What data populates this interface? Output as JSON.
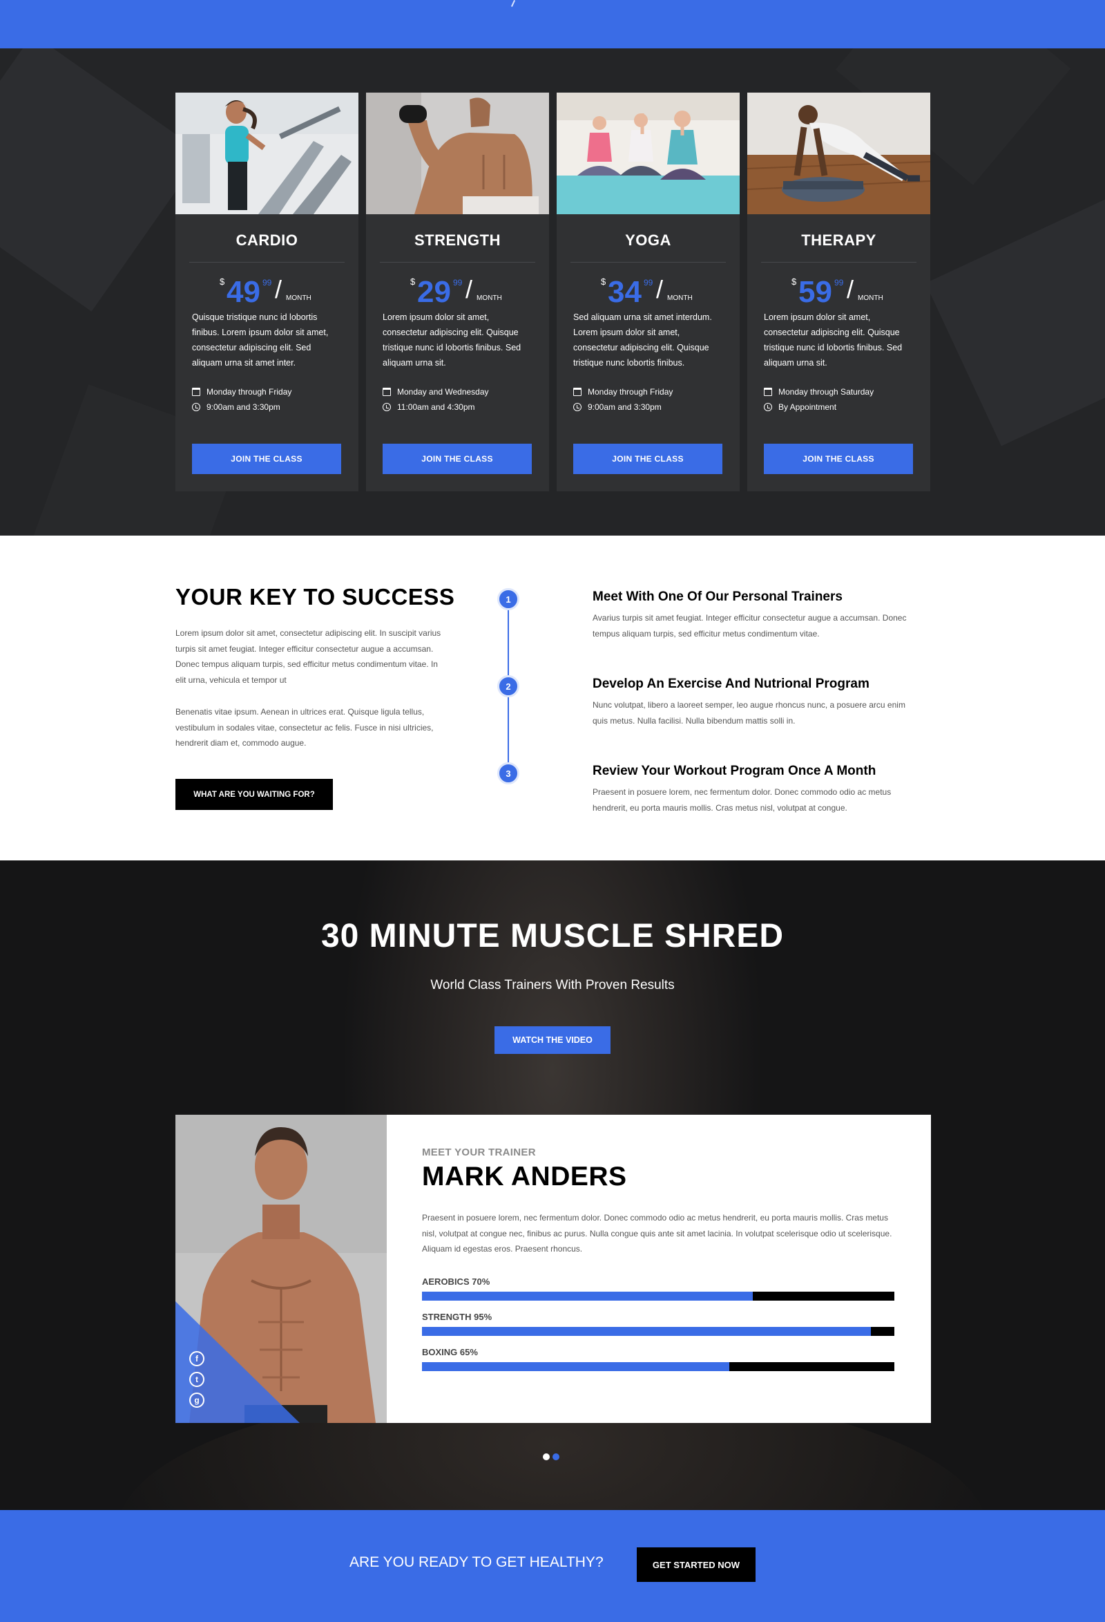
{
  "classes": [
    {
      "name": "CARDIO",
      "currency": "$",
      "amount": "49",
      "cents": "99",
      "period": "MONTH",
      "description": "Quisque tristique nunc id lobortis finibus. Lorem ipsum dolor sit amet, consectetur adipiscing elit. Sed aliquam urna sit amet inter.",
      "days": "Monday through Friday",
      "times": "9:00am and 3:30pm",
      "button": "JOIN THE CLASS"
    },
    {
      "name": "STRENGTH",
      "currency": "$",
      "amount": "29",
      "cents": "99",
      "period": "MONTH",
      "description": "Lorem ipsum dolor sit amet, consectetur adipiscing elit. Quisque tristique nunc id lobortis finibus. Sed aliquam urna sit.",
      "days": "Monday and Wednesday",
      "times": "11:00am and 4:30pm",
      "button": "JOIN THE CLASS"
    },
    {
      "name": "YOGA",
      "currency": "$",
      "amount": "34",
      "cents": "99",
      "period": "MONTH",
      "description": "Sed aliquam urna sit amet interdum. Lorem ipsum dolor sit amet, consectetur adipiscing elit. Quisque tristique nunc lobortis finibus.",
      "days": "Monday through Friday",
      "times": "9:00am and 3:30pm",
      "button": "JOIN THE CLASS"
    },
    {
      "name": "THERAPY",
      "currency": "$",
      "amount": "59",
      "cents": "99",
      "period": "MONTH",
      "description": "Lorem ipsum dolor sit amet, consectetur adipiscing elit. Quisque tristique nunc id lobortis finibus. Sed aliquam urna sit.",
      "days": "Monday through Saturday",
      "times": "By Appointment",
      "button": "JOIN THE CLASS"
    }
  ],
  "success": {
    "title": "YOUR KEY TO SUCCESS",
    "paragraph1": "Lorem ipsum dolor sit amet, consectetur adipiscing elit. In suscipit varius turpis sit amet feugiat. Integer efficitur consectetur augue a accumsan. Donec tempus aliquam turpis, sed efficitur metus condimentum vitae. In elit urna, vehicula et tempor ut",
    "paragraph2": "Benenatis vitae ipsum. Aenean in ultrices erat. Quisque ligula tellus, vestibulum in sodales vitae, consectetur ac felis. Fusce in nisi ultricies, hendrerit diam et, commodo augue.",
    "button": "WHAT ARE YOU WAITING FOR?",
    "steps": [
      {
        "number": "1",
        "title": "Meet With One Of Our Personal Trainers",
        "text": "Avarius turpis sit amet feugiat. Integer efficitur consectetur augue a accumsan. Donec tempus aliquam turpis, sed efficitur metus condimentum vitae."
      },
      {
        "number": "2",
        "title": "Develop An Exercise And Nutrional Program",
        "text": "Nunc volutpat, libero a laoreet semper, leo augue rhoncus nunc, a posuere arcu enim quis metus. Nulla facilisi. Nulla bibendum mattis solli in."
      },
      {
        "number": "3",
        "title": "Review Your Workout Program Once A Month",
        "text": "Praesent in posuere lorem, nec fermentum dolor. Donec commodo odio ac metus hendrerit, eu porta mauris mollis. Cras metus nisl, volutpat at congue."
      }
    ]
  },
  "shred": {
    "title": "30 MINUTE MUSCLE SHRED",
    "subtitle": "World Class Trainers With Proven Results",
    "button": "WATCH THE VIDEO"
  },
  "trainer": {
    "kicker": "MEET YOUR TRAINER",
    "name": "MARK ANDERS",
    "bio": "Praesent in posuere lorem, nec fermentum dolor. Donec commodo odio ac metus hendrerit, eu porta mauris mollis. Cras metus nisl, volutpat at congue nec, finibus ac purus. Nulla congue quis ante sit amet lacinia. In volutpat scelerisque odio ut scelerisque. Aliquam id egestas eros. Praesent rhoncus.",
    "skills": [
      {
        "label": "AEROBICS 70%",
        "percent": 70
      },
      {
        "label": "STRENGTH 95%",
        "percent": 95
      },
      {
        "label": "BOXING 65%",
        "percent": 65
      }
    ],
    "social": [
      {
        "icon": "facebook-icon",
        "glyph": "f"
      },
      {
        "icon": "twitter-icon",
        "glyph": "t"
      },
      {
        "icon": "google-plus-icon",
        "glyph": "g"
      }
    ]
  },
  "carousel": {
    "active_index": 0,
    "count": 2
  },
  "cta": {
    "text": "ARE YOU READY TO GET HEALTHY?",
    "button": "GET STARTED NOW"
  },
  "colors": {
    "accent": "#3a6ce6",
    "dark": "#242527",
    "card": "#303133",
    "black": "#000000"
  }
}
